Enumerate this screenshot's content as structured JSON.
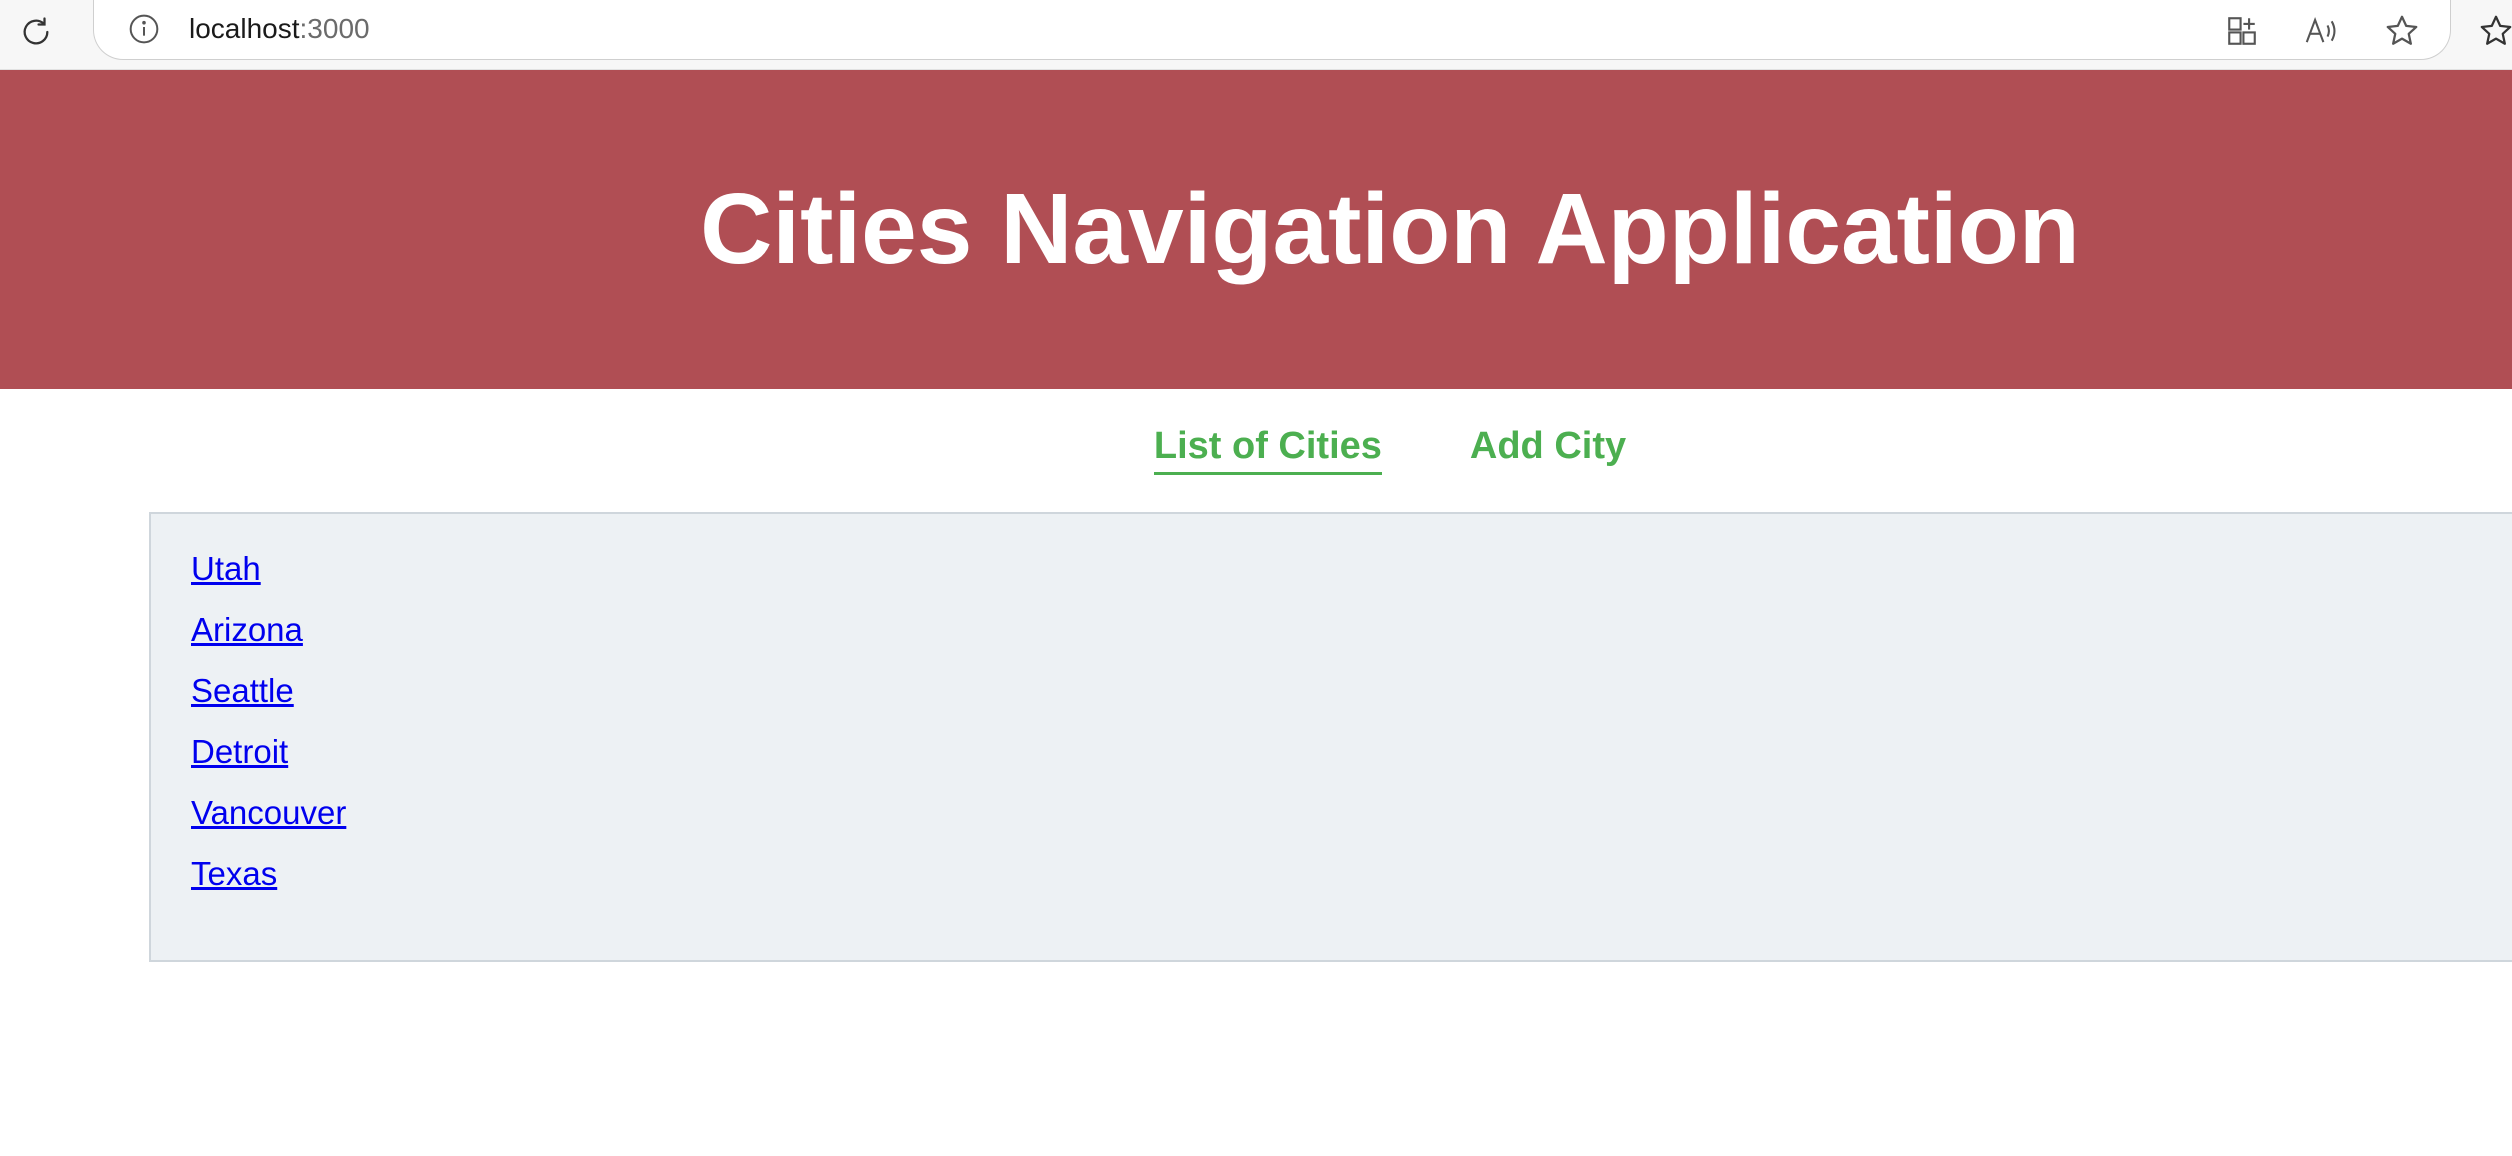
{
  "browser": {
    "url_host": "localhost",
    "url_port": ":3000",
    "icons": [
      "reload-icon",
      "info-icon",
      "split-screen-icon",
      "read-aloud-icon",
      "favorite-star-icon",
      "favorites-icon"
    ]
  },
  "header": {
    "title": "Cities Navigation Application",
    "background_color": "#b04e54"
  },
  "nav": {
    "items": [
      {
        "label": "List of Cities",
        "active": true
      },
      {
        "label": "Add City",
        "active": false
      }
    ],
    "accent_color": "#4caf50"
  },
  "cities": [
    "Utah",
    "Arizona",
    "Seattle",
    "Detroit",
    "Vancouver",
    "Texas"
  ]
}
